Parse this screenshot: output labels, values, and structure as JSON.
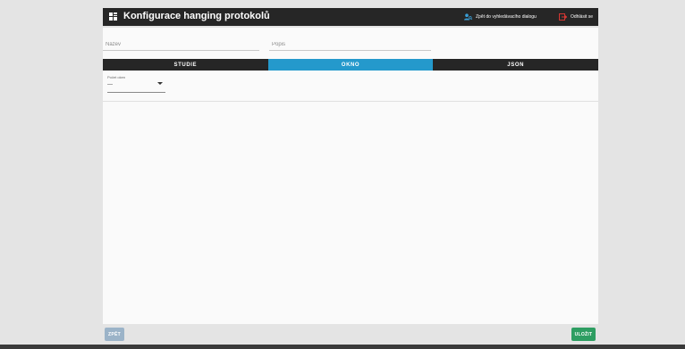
{
  "header": {
    "title": "Konfigurace hanging protokolů",
    "back_link": "Zpět do vyhledávacího dialogu",
    "logout_link": "Odhlásit se"
  },
  "form": {
    "name_placeholder": "Název",
    "description_placeholder": "Popis"
  },
  "tabs": [
    {
      "label": "STUDIE",
      "active": false
    },
    {
      "label": "OKNO",
      "active": true
    },
    {
      "label": "JSON",
      "active": false
    }
  ],
  "okno": {
    "window_count_label": "Počet oken",
    "window_count_value": "—"
  },
  "footer": {
    "back_button": "ZPĚT",
    "save_button": "ULOŽIT"
  },
  "colors": {
    "header": "#262626",
    "accent_tab": "#2499cc",
    "save": "#2e9e62",
    "back_disabled": "#9bb3c8",
    "back_link_icon": "#3aa0d8",
    "logout_icon": "#e53935"
  },
  "icons": {
    "app": "grid-icon",
    "back_link": "user-search-icon",
    "logout": "logout-icon",
    "select": "chevron-down-icon"
  }
}
